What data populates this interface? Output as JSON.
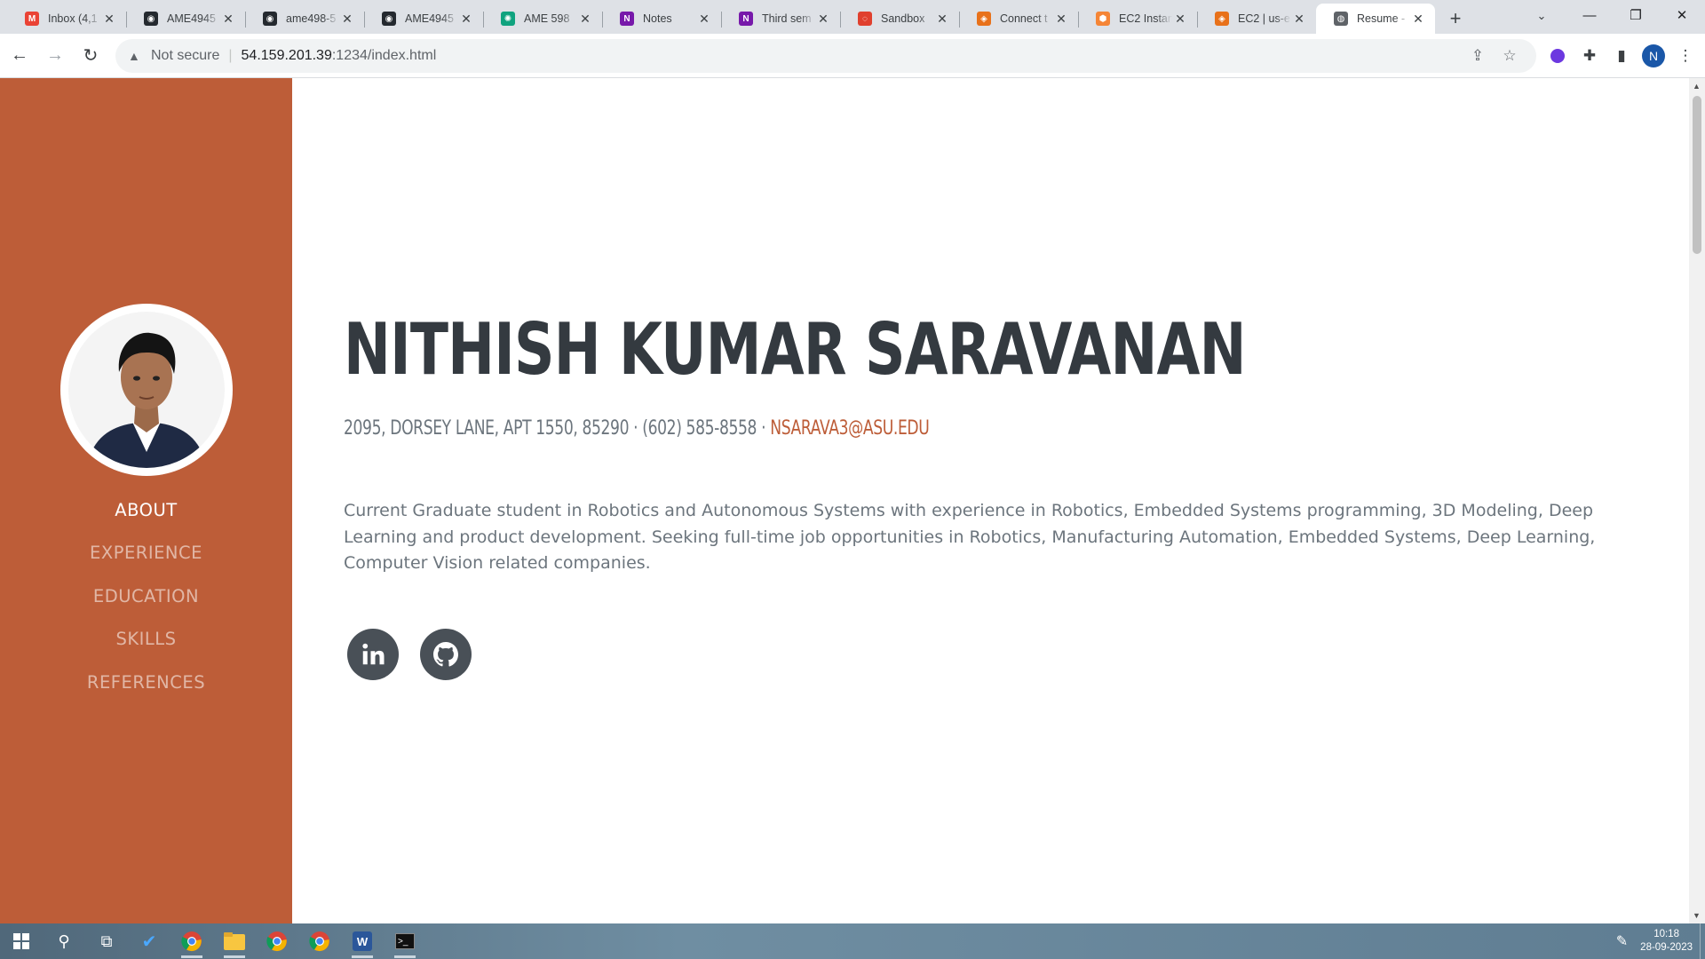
{
  "browser": {
    "tabs": [
      {
        "title": "Inbox (4,1",
        "icon": "gmail-icon",
        "color": "#ea4335",
        "glyph": "M"
      },
      {
        "title": "AME4945",
        "icon": "github-icon",
        "color": "#24292f",
        "glyph": "◉"
      },
      {
        "title": "ame498-5",
        "icon": "github-icon",
        "color": "#24292f",
        "glyph": "◉"
      },
      {
        "title": "AME4945",
        "icon": "github-icon",
        "color": "#24292f",
        "glyph": "◉"
      },
      {
        "title": "AME 598",
        "icon": "chatgpt-icon",
        "color": "#10a37f",
        "glyph": "✺"
      },
      {
        "title": "Notes",
        "icon": "onenote-icon",
        "color": "#7719aa",
        "glyph": "N"
      },
      {
        "title": "Third sem",
        "icon": "onenote-icon",
        "color": "#7719aa",
        "glyph": "N"
      },
      {
        "title": "Sandbox",
        "icon": "sandbox-icon",
        "color": "#e0402e",
        "glyph": "◌"
      },
      {
        "title": "Connect t",
        "icon": "aws-icon",
        "color": "#e8711a",
        "glyph": "◈"
      },
      {
        "title": "EC2 Instan",
        "icon": "ec2-icon",
        "color": "#f58536",
        "glyph": "⬢"
      },
      {
        "title": "EC2 | us-e",
        "icon": "aws-icon",
        "color": "#e8711a",
        "glyph": "◈"
      },
      {
        "title": "Resume -",
        "icon": "globe-icon",
        "color": "#5f6368",
        "glyph": "◍"
      }
    ],
    "active_tab": 11,
    "security_label": "Not secure",
    "url_host": "54.159.201.39",
    "url_path": ":1234/index.html",
    "profile_initial": "N"
  },
  "sidebar": {
    "nav": [
      "About",
      "Experience",
      "Education",
      "Skills",
      "References"
    ],
    "active": 0,
    "accent": "#bd5d38"
  },
  "about": {
    "first_name": "NITHISH",
    "last_name": "KUMAR SARAVANAN",
    "address": "2095, DORSEY LANE, APT 1550, 85290 · (602) 585-8558 ·",
    "email": "NSARAVA3@ASU.EDU",
    "bio": "Current Graduate student in Robotics and Autonomous Systems with experience in Robotics, Embedded Systems programming, 3D Modeling, Deep Learning and product development. Seeking full-time job opportunities in Robotics, Manufacturing Automation, Embedded Systems, Deep Learning, Computer Vision related companies."
  },
  "social": [
    "linkedin-icon",
    "github-icon"
  ],
  "taskbar": {
    "time": "10:18",
    "date": "28-09-2023"
  }
}
